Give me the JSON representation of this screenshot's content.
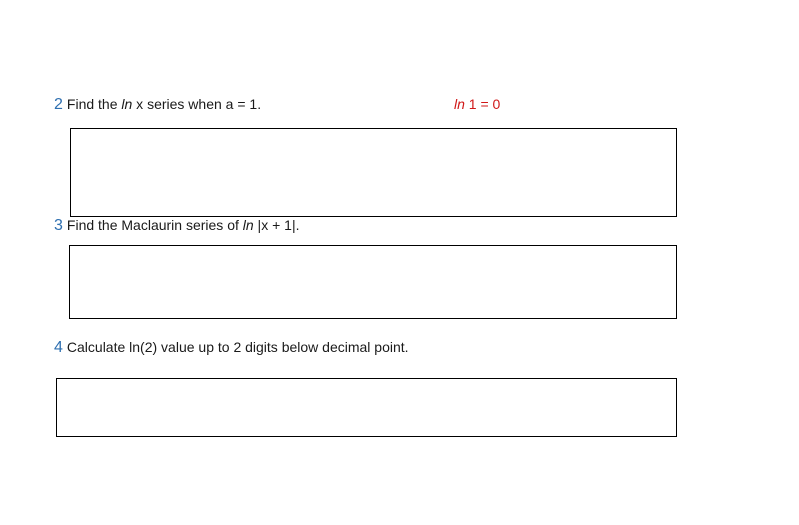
{
  "questions": [
    {
      "number": "2",
      "pre": "Find the ",
      "fn": "ln",
      "post": " x series when a = 1.",
      "hint": {
        "fn": "ln",
        "text": " 1 = 0"
      }
    },
    {
      "number": "3",
      "pre": "Find the Maclaurin series of ",
      "fn": "ln",
      "post": " |x + 1|."
    },
    {
      "number": "4",
      "text": "Calculate ln(2) value up to 2 digits below decimal point."
    }
  ],
  "colors": {
    "number": "#2e6fb0",
    "hint": "#d01818",
    "border": "#000000"
  }
}
